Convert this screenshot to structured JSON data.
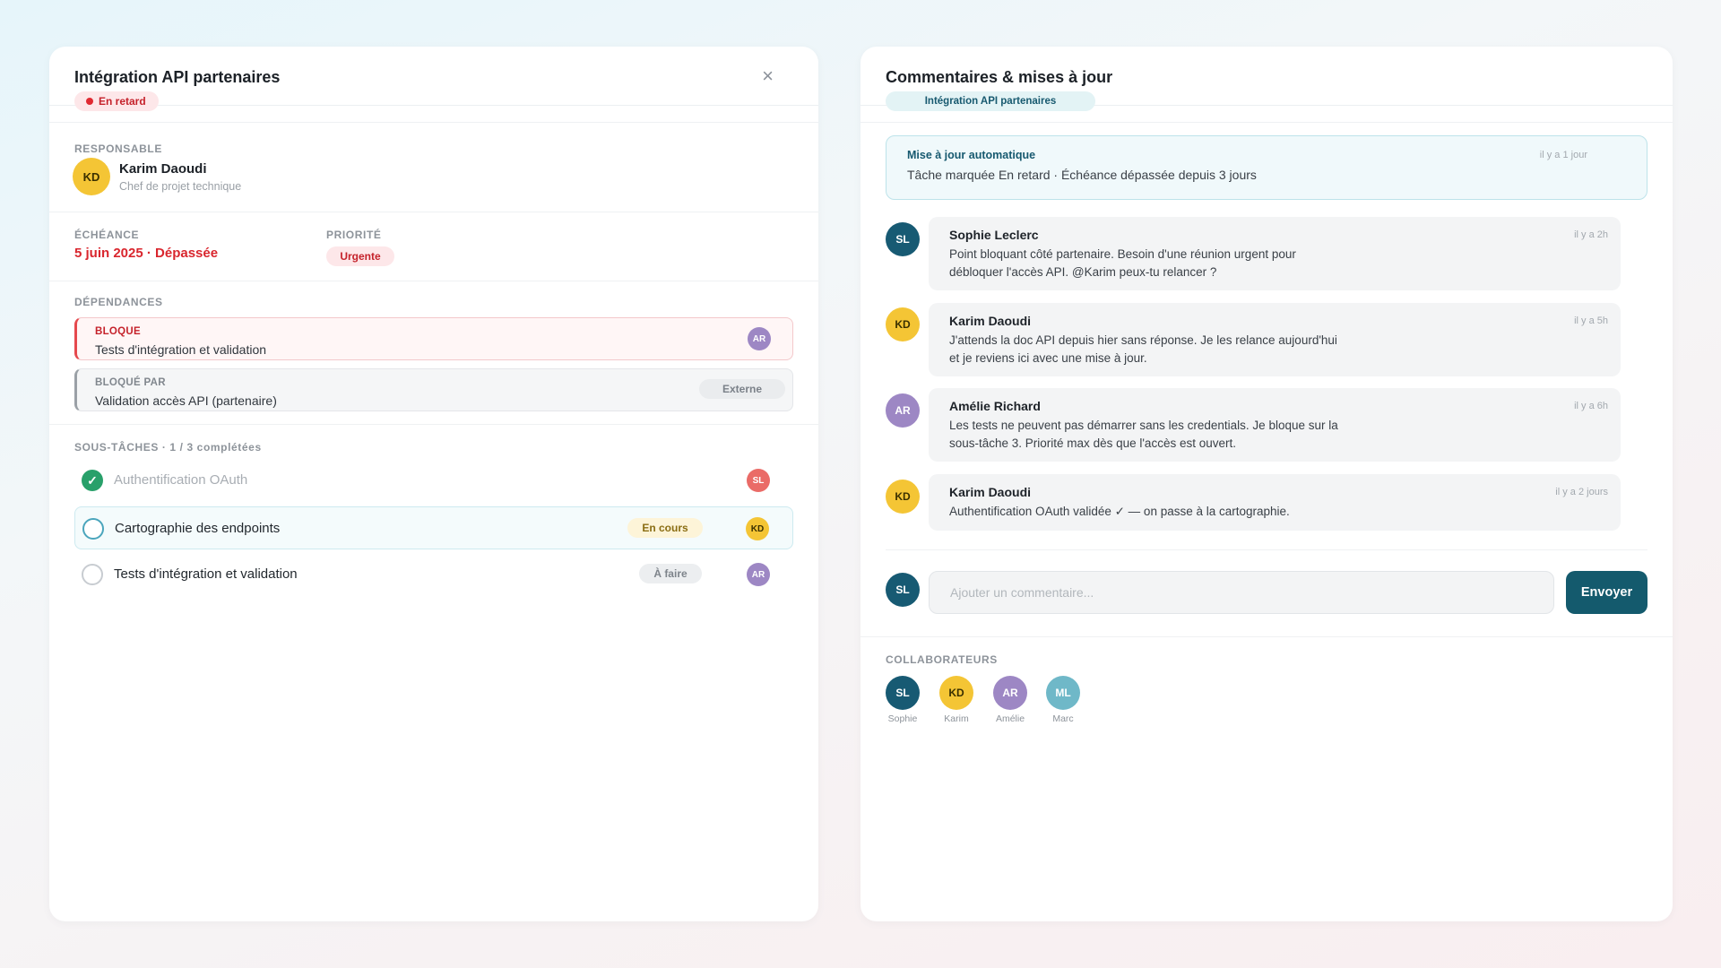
{
  "task": {
    "title": "Intégration API partenaires",
    "status_badge": "En retard",
    "close_icon": "close-icon",
    "owner_label": "RESPONSABLE",
    "owner": {
      "initials": "KD",
      "name": "Karim Daoudi",
      "role": "Chef de projet technique"
    },
    "due_label": "ÉCHÉANCE",
    "due_value": "5 juin 2025 · Dépassée",
    "priority_label": "PRIORITÉ",
    "priority_value": "Urgente",
    "deps_label": "DÉPENDANCES",
    "dependencies": [
      {
        "kind": "BLOQUE",
        "title": "Tests d'intégration et validation",
        "assignee": "AR"
      },
      {
        "kind": "BLOQUÉ PAR",
        "title": "Validation accès API (partenaire)",
        "tag": "Externe"
      }
    ],
    "subtasks_label": "SOUS-TÂCHES · 1 / 3 complétées",
    "subtasks": [
      {
        "title": "Authentification OAuth",
        "done": true,
        "assignee": "SL"
      },
      {
        "title": "Cartographie des endpoints",
        "status": "En cours",
        "assignee": "KD"
      },
      {
        "title": "Tests d'intégration et validation",
        "status": "À faire",
        "assignee": "AR"
      }
    ]
  },
  "comments": {
    "title": "Commentaires & mises à jour",
    "project_badge": "Intégration API partenaires",
    "auto_update": {
      "label": "Mise à jour automatique",
      "text": "Tâche marquée En retard · Échéance dépassée depuis 3 jours",
      "time": "il y a 1 jour"
    },
    "messages": [
      {
        "initials": "SL",
        "author": "Sophie Leclerc",
        "time": "il y a 2h",
        "text": "Point bloquant côté partenaire. Besoin d'une réunion urgent pour débloquer l'accès API. @Karim peux-tu relancer ?"
      },
      {
        "initials": "KD",
        "author": "Karim Daoudi",
        "time": "il y a 5h",
        "text": "J'attends la doc API depuis hier sans réponse. Je les relance aujourd'hui et je reviens ici avec une mise à jour."
      },
      {
        "initials": "AR",
        "author": "Amélie Richard",
        "time": "il y a 6h",
        "text": "Les tests ne peuvent pas démarrer sans les credentials. Je bloque sur la sous-tâche 3. Priorité max dès que l'accès est ouvert."
      },
      {
        "initials": "KD",
        "author": "Karim Daoudi",
        "time": "il y a 2 jours",
        "text": "Authentification OAuth validée ✓ — on passe à la cartographie."
      }
    ],
    "composer": {
      "initials": "SL",
      "placeholder": "Ajouter un commentaire...",
      "send_label": "Envoyer"
    },
    "collaborators_label": "COLLABORATEURS",
    "collaborators": [
      {
        "initials": "SL",
        "name": "Sophie"
      },
      {
        "initials": "KD",
        "name": "Karim"
      },
      {
        "initials": "AR",
        "name": "Amélie"
      },
      {
        "initials": "ML",
        "name": "Marc"
      }
    ]
  },
  "colors": {
    "late": "#e02a32",
    "accent": "#145a6d",
    "done": "#28a06a",
    "avatar_sl": "#175a73",
    "avatar_kd": "#f4c535",
    "avatar_ar": "#9d87c4",
    "avatar_ml": "#6fb8c8"
  }
}
